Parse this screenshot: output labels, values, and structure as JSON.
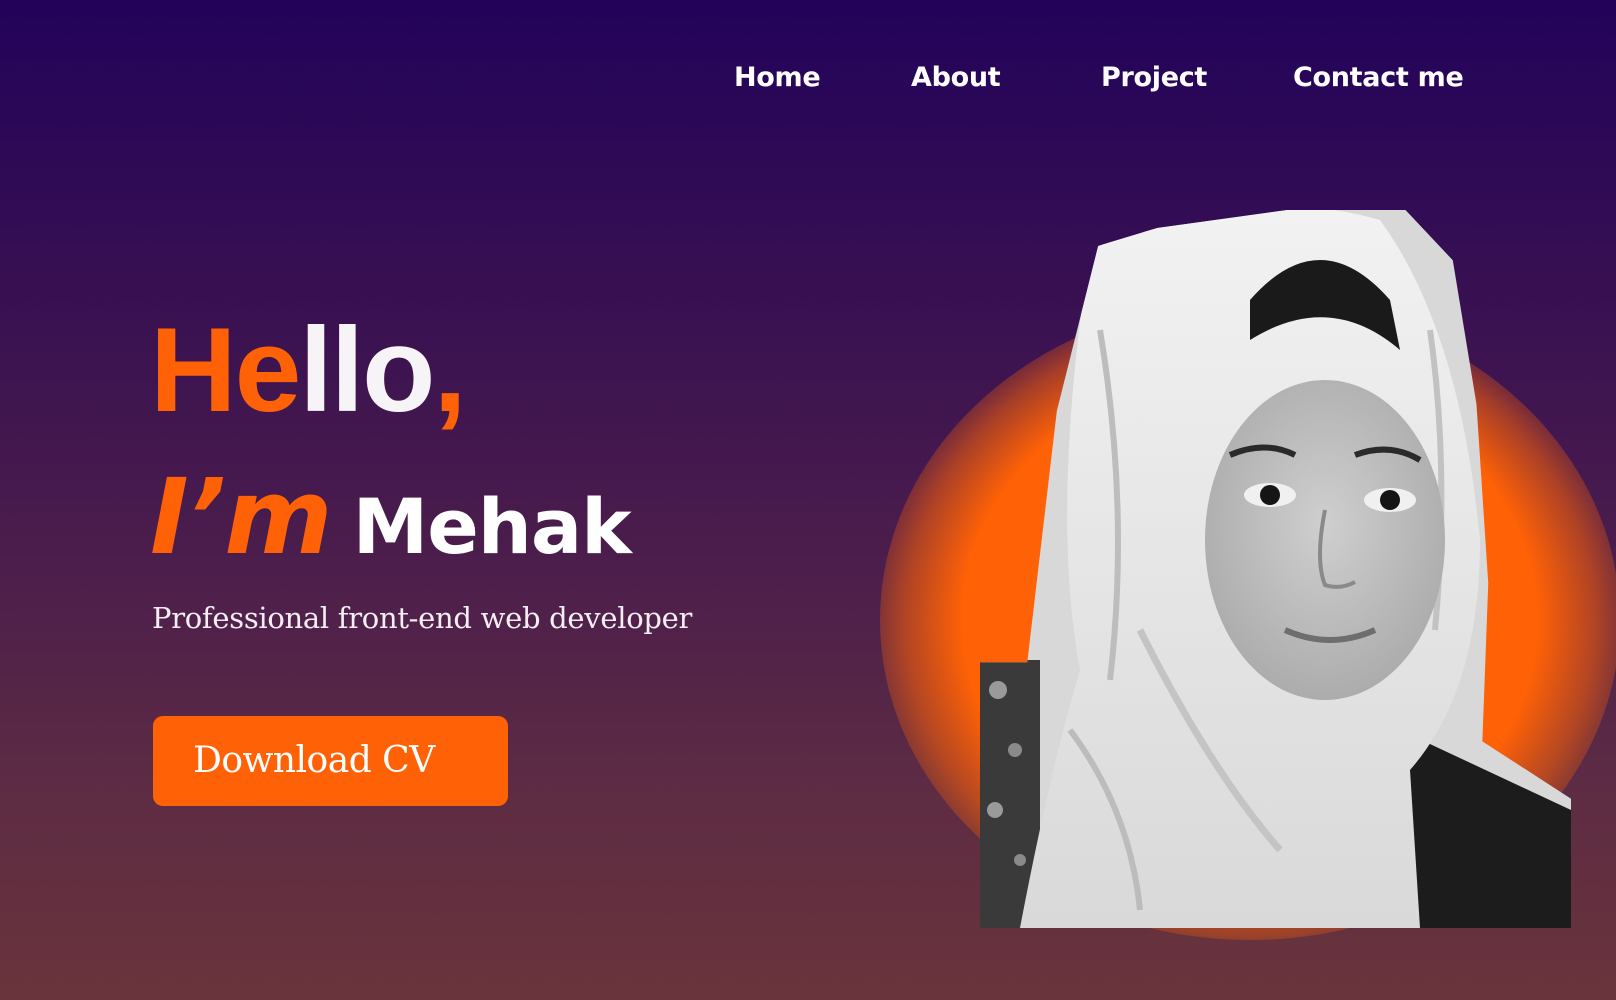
{
  "nav": {
    "items": [
      {
        "label": "Home"
      },
      {
        "label": "About"
      },
      {
        "label": "Project"
      },
      {
        "label": "Contact me"
      }
    ]
  },
  "hero": {
    "greeting_accent": "He",
    "greeting_rest": "llo",
    "greeting_comma": ",",
    "intro_prefix": "I’m",
    "name": "Mehak",
    "tagline": "Professional front-end web developer",
    "cta_label": "Download CV"
  },
  "colors": {
    "accent": "#ff6106",
    "bg_top": "#22025a",
    "bg_bottom": "#6a343b",
    "text": "#ffffff"
  },
  "portrait": {
    "icon": "portrait-photo",
    "style": "grayscale"
  }
}
